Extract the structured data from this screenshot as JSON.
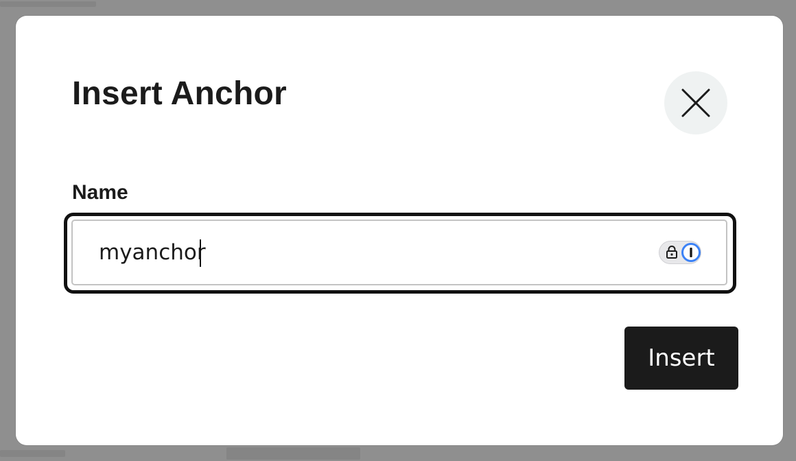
{
  "dialog": {
    "title": "Insert Anchor",
    "close_icon": "close-icon",
    "field": {
      "label": "Name",
      "value": "myanchor",
      "password_manager_icons": [
        "lock-icon",
        "1password-icon"
      ]
    },
    "insert_label": "Insert"
  },
  "colors": {
    "overlay": "#8f8f8f",
    "dialog_bg": "#ffffff",
    "primary_button": "#1b1b1b",
    "close_button_bg": "#eff2f2",
    "password_manager_accent": "#3c82f6"
  }
}
